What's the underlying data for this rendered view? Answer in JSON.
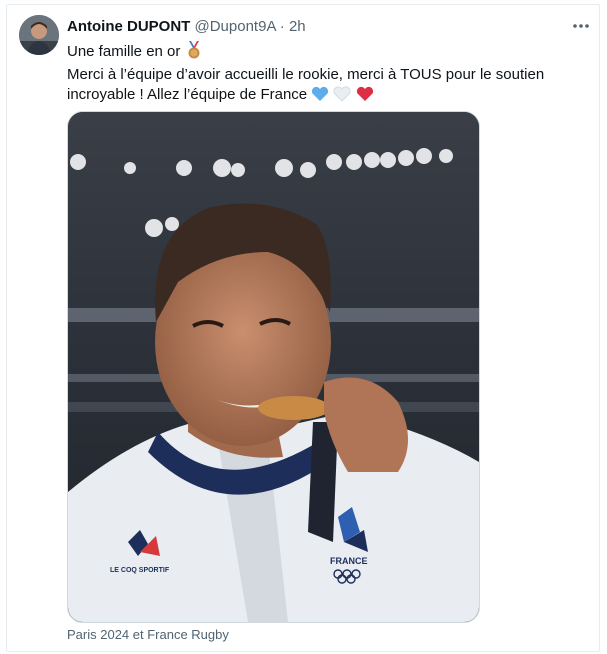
{
  "author": {
    "name": "Antoine DUPONT",
    "handle": "@Dupont9A",
    "separator": "·",
    "time": "2h"
  },
  "tweet": {
    "line1": "Une famille en or",
    "line1_emoji": "medal-icon",
    "line2": "Merci à l’équipe d’avoir accueilli le rookie, merci à TOUS pour le soutien",
    "line3": "incroyable ! Allez l’équipe de France",
    "line3_emojis": [
      "blue-heart-icon",
      "white-heart-icon",
      "red-heart-icon"
    ]
  },
  "media": {
    "caption": "Paris 2024 et France Rugby",
    "shirt_labels": {
      "brand": "LE COQ SPORTIF",
      "team": "FRANCE"
    }
  },
  "colors": {
    "text_primary": "#0f1419",
    "text_secondary": "#536471",
    "border": "#cfd9de",
    "heart_blue": "#5dadec",
    "heart_white": "#e8eef2",
    "heart_red": "#dd2e44",
    "medal": "#c98a45"
  }
}
